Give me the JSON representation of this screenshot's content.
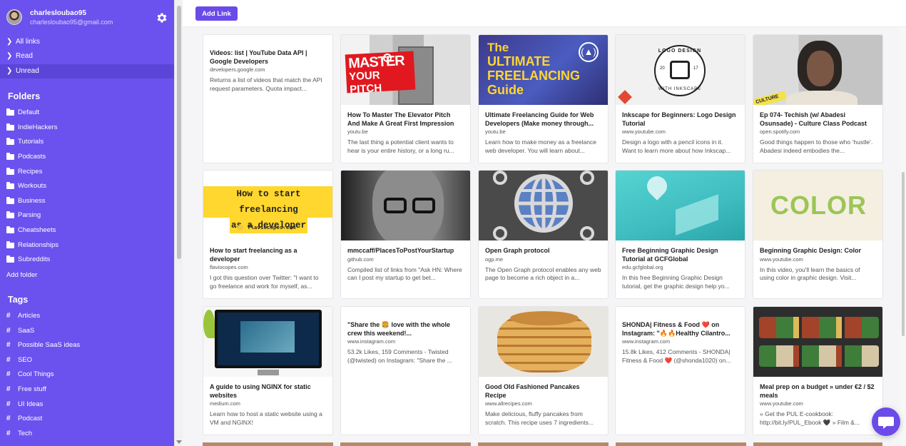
{
  "user": {
    "username": "charlesloubao95",
    "email": "charlesloubao95@gmail.com"
  },
  "sidebar": {
    "nav": [
      {
        "label": "All links"
      },
      {
        "label": "Read"
      },
      {
        "label": "Unread"
      }
    ],
    "folders_title": "Folders",
    "folders": [
      "Default",
      "IndieHackers",
      "Tutorials",
      "Podcasts",
      "Recipes",
      "Workouts",
      "Business",
      "Parsing",
      "Cheatsheets",
      "Relationships",
      "Subreddits"
    ],
    "add_folder": "Add folder",
    "tags_title": "Tags",
    "tags": [
      "Articles",
      "SaaS",
      "Possible SaaS ideas",
      "SEO",
      "Cool Things",
      "Free stuff",
      "UI Ideas",
      "Podcast",
      "Tech"
    ]
  },
  "toolbar": {
    "add_link": "Add Link"
  },
  "colors": {
    "sidebar": "#6b52ee",
    "accent": "#6a4be9"
  },
  "cards": [
    {
      "title": "Videos: list | YouTube Data API | Google Developers",
      "domain": "developers.google.com",
      "desc": "Returns a list of videos that match the API request parameters. Quota impact...",
      "image": "none"
    },
    {
      "title": "How To Master The Elevator Pitch And Make A Great First Impression",
      "domain": "youtu.be",
      "desc": "The last thing a potential client wants to hear is your entire history, or a long ru...",
      "image": "master-your-pitch"
    },
    {
      "title": "Ultimate Freelancing Guide for Web Developers (Make money through...",
      "domain": "youtu.be",
      "desc": "Learn how to make money as a freelance web developer. You will learn about...",
      "image": "ultimate-freelancing"
    },
    {
      "title": "Inkscape for Beginners: Logo Design Tutorial",
      "domain": "www.youtube.com",
      "desc": "Design a logo with a pencil icons in it. Want to learn more about how Inkscap...",
      "image": "logo-design"
    },
    {
      "title": "Ep 074- Techish (w/ Abadesi Osunsade) - Culture Class Podcast",
      "domain": "open.spotify.com",
      "desc": "Good things happen to those who ‘hustle’. Abadesi indeed embodies the...",
      "image": "podcast"
    },
    {
      "title": "How to start freelancing as a developer",
      "domain": "flaviocopes.com",
      "desc": "I got this question over Twitter: \"I want to go freelance and work for myself, as...",
      "image": "flavio"
    },
    {
      "title": "mmccaff/PlacesToPostYourStartup",
      "domain": "github.com",
      "desc": "Compiled list of links from \"Ask HN: Where can I post my startup to get bet...",
      "image": "github"
    },
    {
      "title": "Open Graph protocol",
      "domain": "ogp.me",
      "desc": "The Open Graph protocol enables any web page to become a rich object in a...",
      "image": "opengraph"
    },
    {
      "title": "Free Beginning Graphic Design Tutorial at GCFGlobal",
      "domain": "edu.gcfglobal.org",
      "desc": "In this free Beginning Graphic Design tutorial, get the graphic design help yo...",
      "image": "gcf"
    },
    {
      "title": "Beginning Graphic Design: Color",
      "domain": "www.youtube.com",
      "desc": "In this video, you'll learn the basics of using color in graphic design. Visit...",
      "image": "color"
    },
    {
      "title": "A guide to using NGINX for static websites",
      "domain": "medium.com",
      "desc": "Learn how to host a static website using a VM and NGINX!",
      "image": "nginx"
    },
    {
      "title": "\"Share the 🍔 love with the whole crew this weekend!...",
      "domain": "www.instagram.com",
      "desc": "53.2k Likes, 159 Comments - Twisted (@twisted) on Instagram: \"Share the ...",
      "image": "none"
    },
    {
      "title": "Good Old Fashioned Pancakes Recipe",
      "domain": "www.allrecipes.com",
      "desc": "Make delicious, fluffy pancakes from scratch. This recipe uses 7 ingredients...",
      "image": "pancakes"
    },
    {
      "title": "SHONDA| Fitness & Food ❤️ on Instagram: \"🔥🔥Healthy Cilantro...",
      "domain": "www.instagram.com",
      "desc": "15.8k Likes, 412 Comments - SHONDA| Fitness & Food ❤️ (@shonda1020) on...",
      "image": "none"
    },
    {
      "title": "Meal prep on a budget » under €2 / $2 meals",
      "domain": "www.youtube.com",
      "desc": "» Get the PUL E-cookbook: http://bit.ly/PUL_Ebook 🖤 » Film &...",
      "image": "meal-prep"
    }
  ],
  "image_text": {
    "master_line1": "MASTER",
    "master_line2": "YOUR PITCH",
    "freelance_line1": "The",
    "freelance_line2": "ULTIMATE",
    "freelance_line3": "FREELANCING",
    "freelance_line4": "Guide",
    "logo_line1": "LOGO DESIGN",
    "logo_line2": "WITH INKSCAPE",
    "logo_badge": "20",
    "logo_badge2": "17",
    "culture": "CULTURE",
    "flavio_line1": "How to start freelancing",
    "flavio_line2": "as a developer",
    "flavio_domain": "flaviocopes.com",
    "color_word": "COLOR"
  }
}
